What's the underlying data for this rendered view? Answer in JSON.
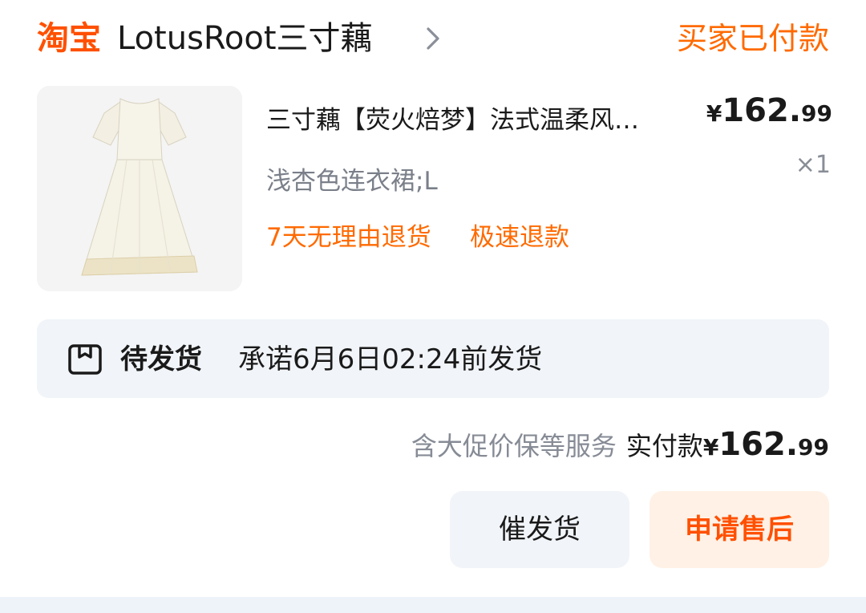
{
  "header": {
    "brand": "淘宝",
    "shop_name": "LotusRoot三寸藕",
    "order_status": "买家已付款"
  },
  "item": {
    "title": "三寸藕【荧火焙梦】法式温柔风…",
    "price_symbol": "¥",
    "price_int": "162.",
    "price_cents": "99",
    "quantity": "×1",
    "variant": "浅杏色连衣裙;L",
    "service_1": "7天无理由退货",
    "service_2": "极速退款"
  },
  "shipping": {
    "status": "待发货",
    "promise": "承诺6月6日02:24前发货",
    "icon": "package-icon"
  },
  "payment": {
    "note": "含大促价保等服务",
    "label": "实付款",
    "symbol": "¥",
    "amount_int": "162.",
    "amount_cents": "99"
  },
  "actions": {
    "remind_label": "催发货",
    "aftersale_label": "申请售后"
  },
  "colors": {
    "brand": "#ff5000",
    "status": "#ff6a00",
    "muted_bg": "#f1f4f8"
  }
}
